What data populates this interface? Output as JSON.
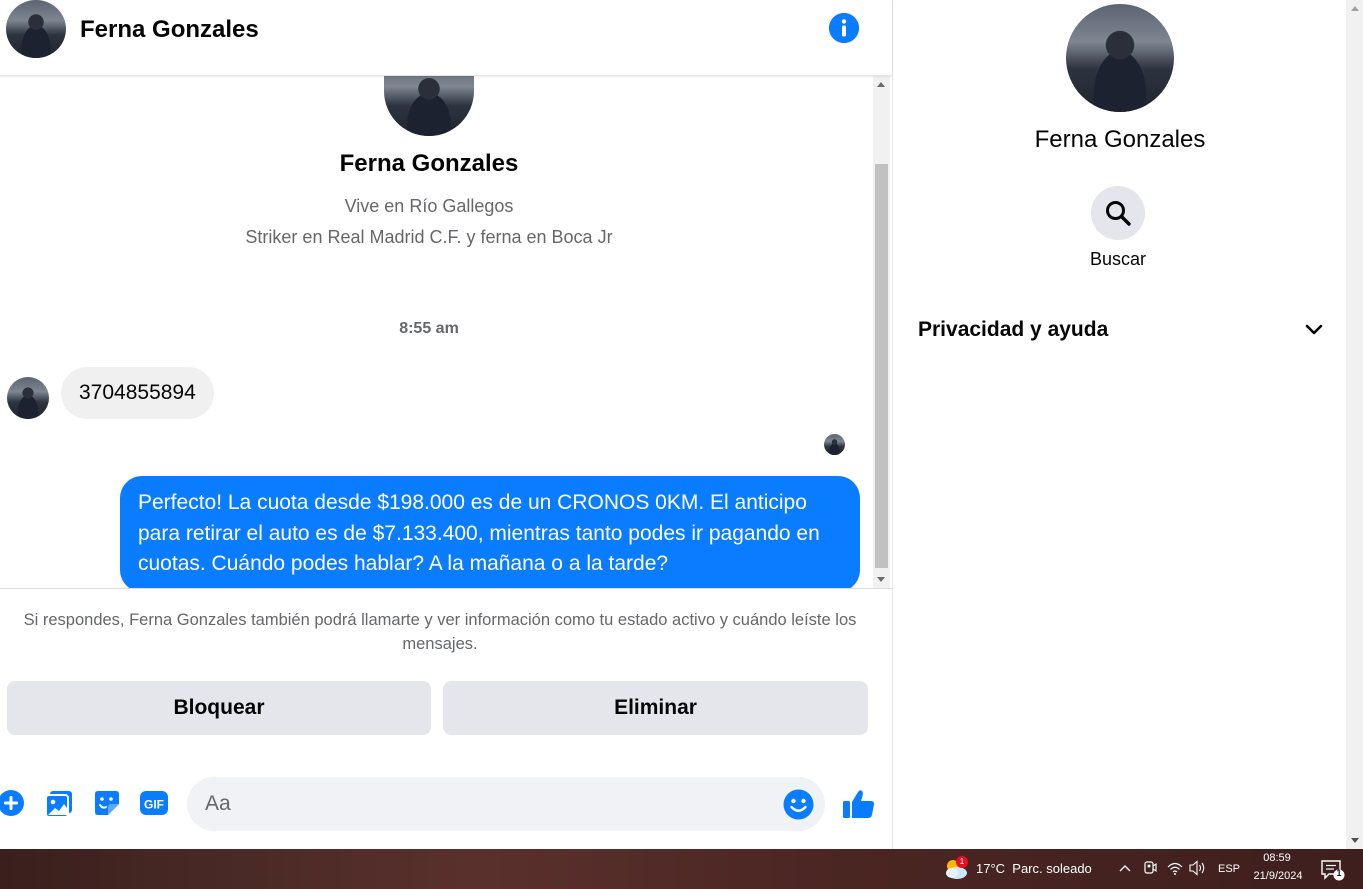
{
  "chat": {
    "header_name": "Ferna Gonzales",
    "profile": {
      "name": "Ferna Gonzales",
      "location": "Vive en Río Gallegos",
      "work": "Striker en Real Madrid C.F. y ferna en Boca Jr"
    },
    "timestamp": "8:55 am",
    "incoming_message": "3704855894",
    "outgoing_message": "Perfecto! La cuota desde $198.000 es de un CRONOS 0KM. El anticipo para retirar el auto es de $7.133.400, mientras tanto podes ir pagando en cuotas. Cuándo podes hablar? A la mañana o a la tarde?",
    "notice": "Si respondes, Ferna Gonzales también podrá llamarte y ver información como tu estado activo y cuándo leíste los mensajes.",
    "buttons": {
      "block": "Bloquear",
      "delete": "Eliminar"
    },
    "composer": {
      "placeholder": "Aa"
    },
    "colors": {
      "accent": "#0a7cff",
      "incoming_bubble": "#f0f0f0",
      "button_bg": "#e4e6eb"
    }
  },
  "sidebar": {
    "name": "Ferna Gonzales",
    "search_label": "Buscar",
    "privacy_label": "Privacidad y ayuda"
  },
  "taskbar": {
    "weather_temp": "17°C",
    "weather_desc": "Parc. soleado",
    "weather_badge": "1",
    "language": "ESP",
    "time": "08:59",
    "date": "21/9/2024",
    "notification_count": "1"
  }
}
